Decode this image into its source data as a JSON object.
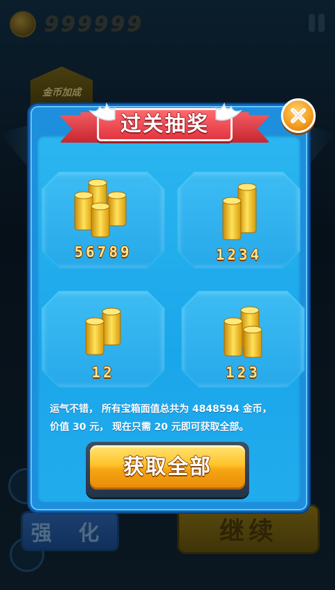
{
  "background": {
    "coin_count": "999999",
    "badge_label": "金币加成",
    "strengthen_label": "强 化",
    "continue_label": "继续"
  },
  "dialog": {
    "title": "过关抽奖",
    "close_icon": "close-icon",
    "rewards": [
      {
        "amount": "56789",
        "icon": "coin-stack-large-icon"
      },
      {
        "amount": "1234",
        "icon": "coin-stack-medium-icon"
      },
      {
        "amount": "12",
        "icon": "coin-stack-small-icon"
      },
      {
        "amount": "123",
        "icon": "coin-stack-medium-icon"
      }
    ],
    "info_line1": "运气不错， 所有宝箱面值总共为 4848594 金币，",
    "info_line2": "价值 30 元， 现在只需 20 元即可获取全部。",
    "claim_all_label": "获取全部"
  },
  "colors": {
    "panel_blue": "#1d8fdc",
    "title_red": "#e13540",
    "gold": "#ffc22a"
  }
}
